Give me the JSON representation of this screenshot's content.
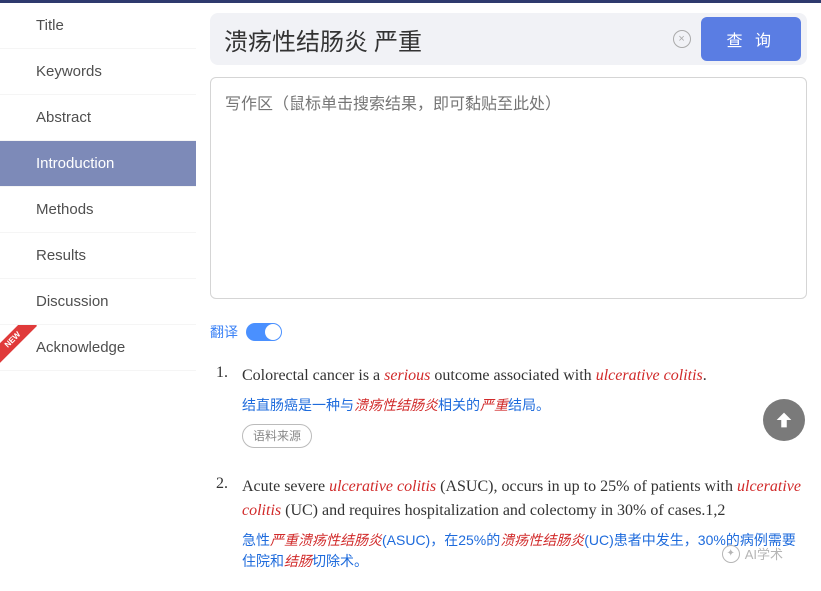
{
  "sidebar": {
    "items": [
      {
        "label": "Title"
      },
      {
        "label": "Keywords"
      },
      {
        "label": "Abstract"
      },
      {
        "label": "Introduction",
        "active": true
      },
      {
        "label": "Methods"
      },
      {
        "label": "Results"
      },
      {
        "label": "Discussion"
      },
      {
        "label": "Acknowledge",
        "new": true
      }
    ],
    "new_badge": "NEW"
  },
  "search": {
    "value": "溃疡性结肠炎 严重",
    "query_button": "查 询",
    "clear_icon": "×"
  },
  "write_area": {
    "placeholder": "写作区（鼠标单击搜索结果，即可黏贴至此处）"
  },
  "translate": {
    "label": "翻译",
    "on": true
  },
  "results": [
    {
      "num": "1.",
      "english_parts": [
        "Colorectal cancer is a ",
        "serious",
        " outcome associated with ",
        "ulcerative colitis",
        "."
      ],
      "chinese_parts": [
        "结直肠癌是一种与",
        "溃疡性结肠炎",
        "相关的",
        "严重",
        "结局。"
      ],
      "source_label": "语料来源"
    },
    {
      "num": "2.",
      "english_parts": [
        "Acute severe ",
        "ulcerative colitis",
        " (ASUC), occurs in up to 25% of patients with ",
        "ulcerative colitis",
        " (UC) and requires hospitalization and colectomy in 30% of cases.1,2"
      ],
      "chinese_parts": [
        "急性",
        "严重溃疡性结肠炎",
        "(ASUC)，在25%的",
        "溃疡性结肠炎",
        "(UC)患者中发生，30%的病例需要住院和",
        "结肠",
        "切除术。"
      ]
    }
  ],
  "watermark": "AI学术"
}
